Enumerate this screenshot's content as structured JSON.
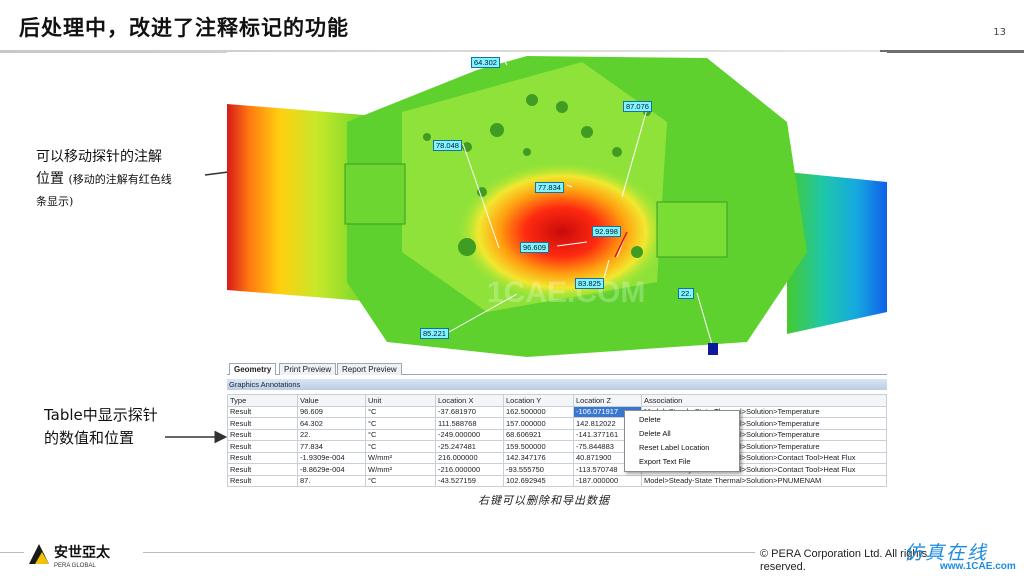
{
  "slide": {
    "title": "后处理中，改进了注释标记的功能",
    "page_number": "13"
  },
  "callouts": {
    "probe_line1": "可以移动探针的注解",
    "probe_line2": "位置",
    "probe_line2_small": "(移动的注解有红色线",
    "probe_line3": "条显示)",
    "table_line1": "Table中显示探针",
    "table_line2": "的数值和位置",
    "caption": "右键可以删除和导出数据"
  },
  "viewport": {
    "probe_labels": [
      "64.302",
      "87.076",
      "78.048",
      "77.834",
      "92.998",
      "96.609",
      "83.825",
      "22.",
      "85.221"
    ],
    "watermark_text": "1CAE.COM"
  },
  "panel": {
    "tabs": [
      "Geometry",
      "Print Preview",
      "Report Preview"
    ],
    "section_title": "Graphics Annotations",
    "columns": [
      "Type",
      "Value",
      "Unit",
      "Location X",
      "Location Y",
      "Location Z",
      "Association"
    ],
    "rows": [
      [
        "Result",
        "96.609",
        "°C",
        "-37.681970",
        "162.500000",
        "-106.071917",
        "Model>Steady-State Thermal>Solution>Temperature"
      ],
      [
        "Result",
        "64.302",
        "°C",
        "111.588768",
        "157.000000",
        "142.812022",
        "Model>Steady-State Thermal>Solution>Temperature"
      ],
      [
        "Result",
        "22.",
        "°C",
        "-249.000000",
        "68.606921",
        "-141.377161",
        "Model>Steady-State Thermal>Solution>Temperature"
      ],
      [
        "Result",
        "77.834",
        "°C",
        "-25.247481",
        "159.500000",
        "-75.844883",
        "Model>Steady-State Thermal>Solution>Temperature"
      ],
      [
        "Result",
        "-1.9309e-004",
        "W/mm²",
        "216.000000",
        "142.347176",
        "40.871900",
        "Model>Steady-State Thermal>Solution>Contact Tool>Heat Flux"
      ],
      [
        "Result",
        "-8.8629e-004",
        "W/mm²",
        "-216.000000",
        "-93.555750",
        "-113.570748",
        "Model>Steady-State Thermal>Solution>Contact Tool>Heat Flux"
      ],
      [
        "Result",
        "87.",
        "°C",
        "-43.527159",
        "102.692945",
        "-187.000000",
        "Model>Steady-State Thermal>Solution>PNUMENAM"
      ]
    ],
    "context_menu": [
      "Delete",
      "Delete All",
      "Reset Label Location",
      "Export Text File"
    ]
  },
  "footer": {
    "logo_text": "安世亞太",
    "logo_subtext": "PERA GLOBAL",
    "copyright_line1": "©  PERA Corporation Ltd. All rights",
    "copyright_line2": "reserved.",
    "watermark": "仿真在线",
    "watermark_url": "www.1CAE.com"
  },
  "colors": {
    "probe_fill": "#7ff6ff",
    "selection": "#3a78d0",
    "watermark": "#1a8be0"
  }
}
